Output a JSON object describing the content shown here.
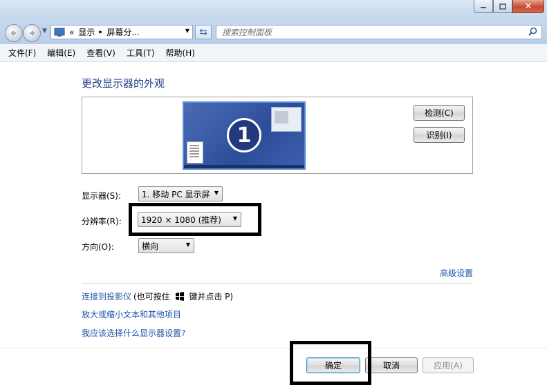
{
  "window": {
    "close_symbol": "✕"
  },
  "navigation": {
    "address_prefix": "«",
    "address_crumb_1": "显示",
    "address_sep": "▸",
    "address_crumb_2": "屏幕分...",
    "search_placeholder": "搜索控制面板"
  },
  "menu": [
    "文件(F)",
    "编辑(E)",
    "查看(V)",
    "工具(T)",
    "帮助(H)"
  ],
  "main": {
    "title": "更改显示器的外观",
    "monitor_number": "1",
    "detect_label": "检测(C)",
    "identify_label": "识别(I)",
    "display_label": "显示器(S):",
    "display_value": "1. 移动 PC 显示屏",
    "resolution_label": "分辨率(R):",
    "resolution_value": "1920 × 1080 (推荐)",
    "orientation_label": "方向(O):",
    "orientation_value": "横向",
    "advanced_link": "高级设置",
    "projector_link": "连接到投影仪",
    "projector_note_before": "(也可按住",
    "projector_note_after": "键并点击 P)",
    "text_size_link": "放大或缩小文本和其他项目",
    "which_display_link": "我应该选择什么显示器设置?"
  },
  "footer": {
    "ok_label": "确定",
    "cancel_label": "取消",
    "apply_label": "应用(A)"
  },
  "icons": [
    "back-arrow-icon",
    "forward-arrow-icon",
    "control-panel-icon",
    "refresh-icon",
    "search-icon",
    "windows-logo-icon",
    "dropdown-arrow-icon"
  ],
  "colors": {
    "title_blue": "#1e3f86",
    "link_blue": "#1e56a8",
    "annotation_box": "#000000"
  }
}
